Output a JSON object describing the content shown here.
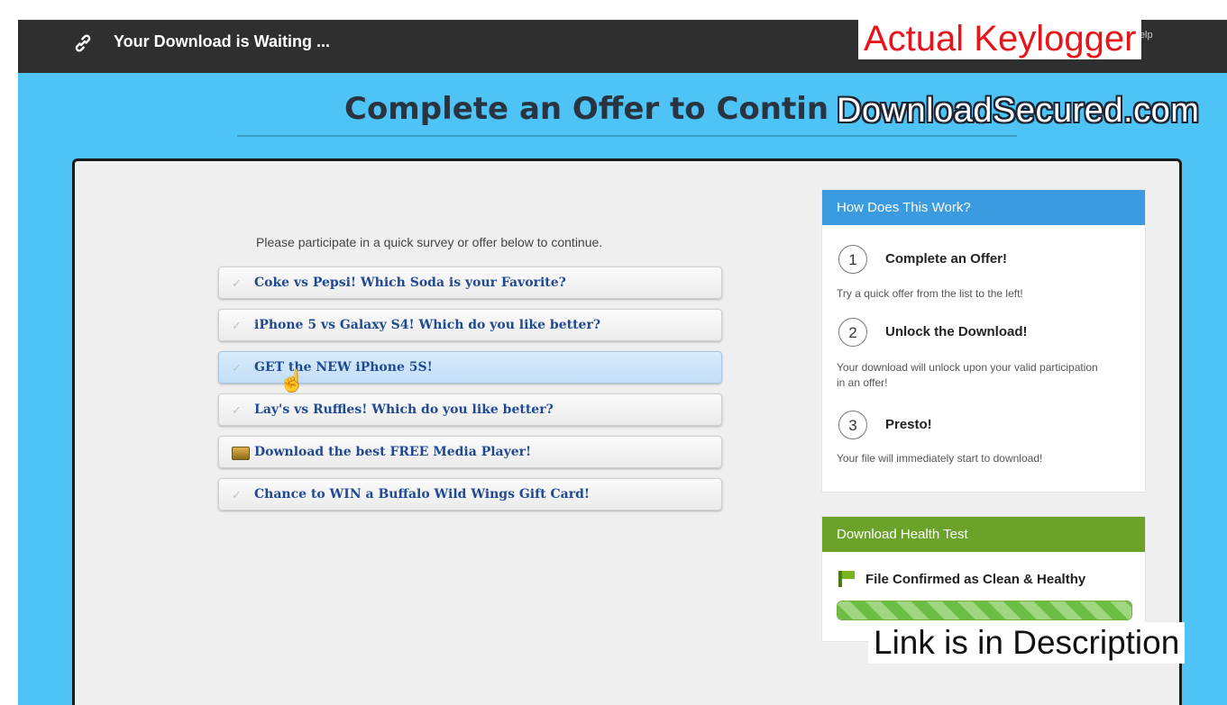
{
  "topbar": {
    "title": "Your Download is Waiting ...",
    "link_icon": "link-icon",
    "help_label": "Help",
    "help_icon": "help-icon"
  },
  "heading": "Complete an Offer to Contin",
  "overlays": {
    "top": "Actual Keylogger",
    "middle": "DownloadSecured.com",
    "bottom": "Link is in Description"
  },
  "main": {
    "instruction": "Please participate in a quick survey or offer below to continue.",
    "offers": [
      {
        "label": "Coke vs Pepsi! Which Soda is your Favorite?",
        "icon": "check-icon"
      },
      {
        "label": "iPhone 5 vs Galaxy S4! Which do you like better?",
        "icon": "check-icon"
      },
      {
        "label": "GET the NEW iPhone 5S!",
        "icon": "check-icon",
        "highlighted": true
      },
      {
        "label": "Lay's vs Ruffles! Which do you like better?",
        "icon": "check-icon"
      },
      {
        "label": "Download the best FREE Media Player!",
        "icon": "media-icon"
      },
      {
        "label": "Chance to WIN a Buffalo Wild Wings Gift Card!",
        "icon": "check-icon"
      }
    ]
  },
  "how_it_works": {
    "header": "How Does This Work?",
    "steps": [
      {
        "num": "1",
        "title": "Complete an Offer!",
        "desc": "Try a quick offer from the list to the left!"
      },
      {
        "num": "2",
        "title": "Unlock the Download!",
        "desc": "Your download will unlock upon your valid participation in an offer!"
      },
      {
        "num": "3",
        "title": "Presto!",
        "desc": "Your file will immediately start to download!"
      }
    ]
  },
  "health": {
    "header": "Download Health Test",
    "status": "File Confirmed as Clean & Healthy",
    "progress": 1.0,
    "icon": "flag-icon"
  },
  "colors": {
    "background": "#4dc4f5",
    "topbar": "#2f2f2f",
    "how_header": "#3a9be0",
    "health_header": "#6aa22a",
    "offer_text": "#1f4a93",
    "overlay_red": "#e8141b"
  }
}
